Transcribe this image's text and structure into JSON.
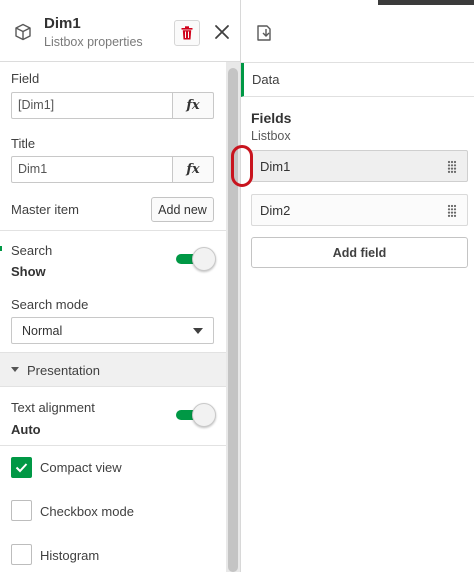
{
  "header": {
    "title": "Dim1",
    "subtitle": "Listbox properties"
  },
  "field": {
    "label": "Field",
    "value": "[Dim1]",
    "fx_label": "fx"
  },
  "title_section": {
    "label": "Title",
    "value": "Dim1",
    "fx_label": "fx"
  },
  "master_item": {
    "label": "Master item",
    "button_label": "Add new"
  },
  "search": {
    "label": "Search",
    "value": "Show",
    "enabled": true
  },
  "search_mode": {
    "label": "Search mode",
    "selected": "Normal"
  },
  "presentation": {
    "label": "Presentation",
    "expanded": true
  },
  "text_alignment": {
    "label": "Text alignment",
    "value": "Auto",
    "enabled": true
  },
  "checkboxes": [
    {
      "label": "Compact view",
      "checked": true
    },
    {
      "label": "Checkbox mode",
      "checked": false
    },
    {
      "label": "Histogram",
      "checked": false
    }
  ],
  "right_panel": {
    "tab_label": "Data",
    "fields_title": "Fields",
    "fields_subtitle": "Listbox",
    "fields": [
      {
        "name": "Dim1",
        "active": true
      },
      {
        "name": "Dim2",
        "active": false
      }
    ],
    "add_field_label": "Add field"
  },
  "colors": {
    "accent_green": "#009845",
    "delete_red": "#d0021b",
    "highlight_ring": "#c8141e"
  }
}
